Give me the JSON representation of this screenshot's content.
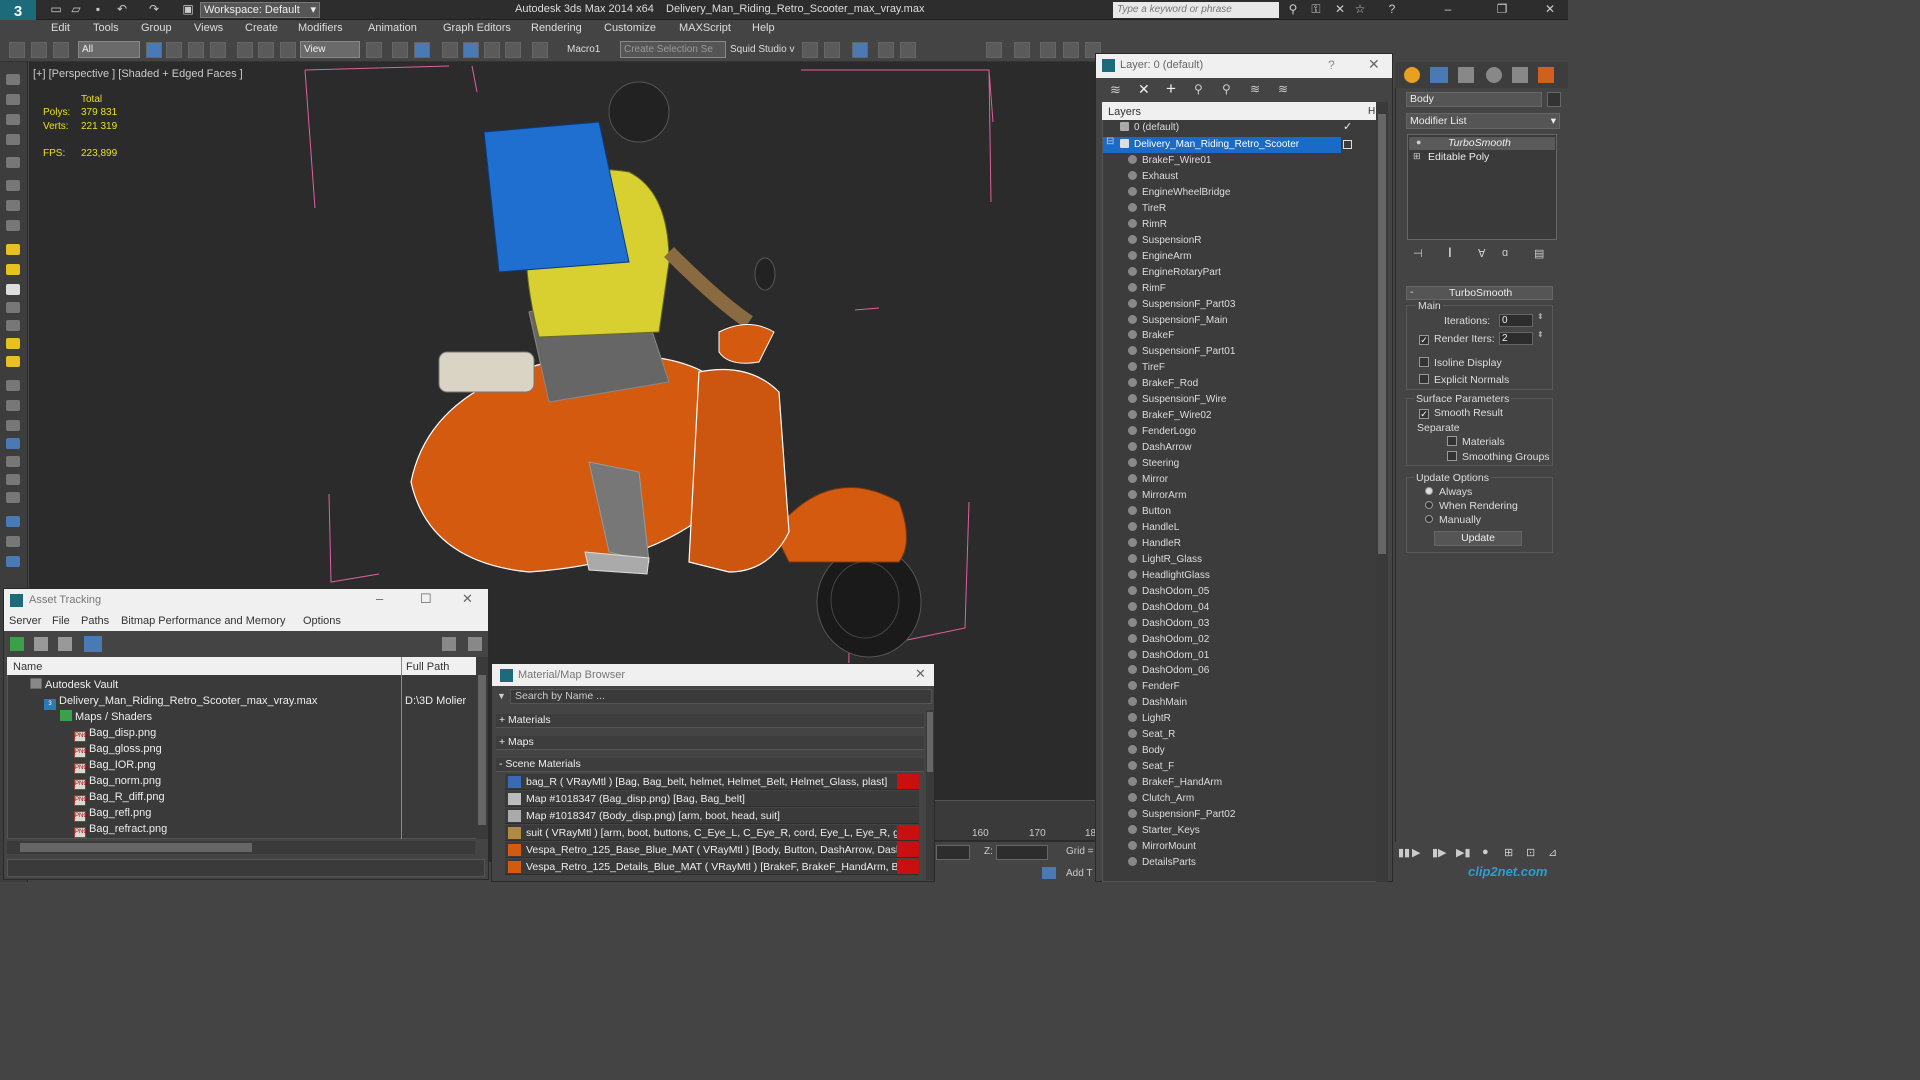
{
  "app": {
    "logo": "3",
    "workspace_label": "Workspace: Default",
    "title": "Autodesk 3ds Max  2014 x64",
    "file": "Delivery_Man_Riding_Retro_Scooter_max_vray.max",
    "search_placeholder": "Type a keyword or phrase"
  },
  "menu": [
    "Edit",
    "Tools",
    "Group",
    "Views",
    "Create",
    "Modifiers",
    "Animation",
    "Graph Editors",
    "Rendering",
    "Customize",
    "MAXScript",
    "Help"
  ],
  "toolbar": {
    "filter": "All",
    "ref_coord": "View",
    "macro": "Macro1",
    "selection_set": "Create Selection Se",
    "squid": "Squid Studio v"
  },
  "viewport": {
    "label": "[+] [Perspective ] [Shaded + Edged Faces ]",
    "stats_total": "Total",
    "polys_label": "Polys:",
    "polys": "379 831",
    "verts_label": "Verts:",
    "verts": "221 319",
    "fps_label": "FPS:",
    "fps": "223,899"
  },
  "layer_window": {
    "title": "Layer: 0 (default)",
    "help": "?",
    "header": "Layers",
    "header_right": "H",
    "default_layer": "0 (default)",
    "selected_layer": "Delivery_Man_Riding_Retro_Scooter",
    "objects": [
      "BrakeF_Wire01",
      "Exhaust",
      "EngineWheelBridge",
      "TireR",
      "RimR",
      "SuspensionR",
      "EngineArm",
      "EngineRotaryPart",
      "RimF",
      "SuspensionF_Part03",
      "SuspensionF_Main",
      "BrakeF",
      "SuspensionF_Part01",
      "TireF",
      "BrakeF_Rod",
      "SuspensionF_Wire",
      "BrakeF_Wire02",
      "FenderLogo",
      "DashArrow",
      "Steering",
      "Mirror",
      "MirrorArm",
      "Button",
      "HandleL",
      "HandleR",
      "LightR_Glass",
      "HeadlightGlass",
      "DashOdom_05",
      "DashOdom_04",
      "DashOdom_03",
      "DashOdom_02",
      "DashOdom_01",
      "DashOdom_06",
      "FenderF",
      "DashMain",
      "LightR",
      "Seat_R",
      "Body",
      "Seat_F",
      "BrakeF_HandArm",
      "Clutch_Arm",
      "SuspensionF_Part02",
      "Starter_Keys",
      "MirrorMount",
      "DetailsParts"
    ]
  },
  "command_panel": {
    "object_name": "Body",
    "modifier_list": "Modifier List",
    "stack": [
      "TurboSmooth",
      "Editable Poly"
    ],
    "rollout_title": "TurboSmooth",
    "main_label": "Main",
    "iterations_label": "Iterations:",
    "iterations": "0",
    "render_iters_label": "Render Iters:",
    "render_iters": "2",
    "isoline": "Isoline Display",
    "explicit_normals": "Explicit Normals",
    "surface_params": "Surface Parameters",
    "smooth_result": "Smooth Result",
    "separate": "Separate",
    "materials": "Materials",
    "smoothing_groups": "Smoothing Groups",
    "update_options": "Update Options",
    "always": "Always",
    "when_rendering": "When Rendering",
    "manually": "Manually",
    "update_button": "Update"
  },
  "asset_tracking": {
    "title": "Asset Tracking",
    "menu": [
      "Server",
      "File",
      "Paths",
      "Bitmap Performance and Memory",
      "Options"
    ],
    "col_name": "Name",
    "col_path": "Full Path",
    "vault": "Autodesk Vault",
    "file": "Delivery_Man_Riding_Retro_Scooter_max_vray.max",
    "file_path": "D:\\3D Molier",
    "maps_group": "Maps / Shaders",
    "maps": [
      "Bag_disp.png",
      "Bag_gloss.png",
      "Bag_IOR.png",
      "Bag_norm.png",
      "Bag_R_diff.png",
      "Bag_refl.png",
      "Bag_refract.png"
    ]
  },
  "material_browser": {
    "title": "Material/Map Browser",
    "search_placeholder": "Search by Name ...",
    "groups": [
      "+ Materials",
      "+ Maps",
      "- Scene Materials"
    ],
    "materials": [
      "bag_R  ( VRayMtl )  [Bag, Bag_belt, helmet, Helmet_Belt, Helmet_Glass, plast]",
      "Map #1018347 (Bag_disp.png)  [Bag, Bag_belt]",
      "Map #1018347 (Body_disp.png)  [arm, boot, head, suit]",
      "suit  ( VRayMtl )  [arm, boot, buttons, C_Eye_L, C_Eye_R, cord, Eye_L, Eye_R, g...",
      "Vespa_Retro_125_Base_Blue_MAT  ( VRayMtl )  [Body, Button, DashArrow, Dash...",
      "Vespa_Retro_125_Details_Blue_MAT  ( VRayMtl )  [BrakeF, BrakeF_HandArm, Br..."
    ]
  },
  "timeline": {
    "t160": "160",
    "t170": "170",
    "t18": "18",
    "z_label": "Z:",
    "grid_label": "Grid =",
    "addt": "Add T"
  },
  "watermark": "clip2net.com"
}
